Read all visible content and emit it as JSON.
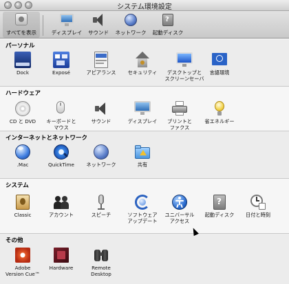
{
  "window": {
    "title": "システム環境設定"
  },
  "toolbar": {
    "items": [
      {
        "label": "すべてを表示",
        "icon": "apple-icon"
      },
      {
        "label": "ディスプレイ",
        "icon": "display-icon"
      },
      {
        "label": "サウンド",
        "icon": "speaker-icon"
      },
      {
        "label": "ネットワーク",
        "icon": "network-globe-icon"
      },
      {
        "label": "起動ディスク",
        "icon": "startup-disk-icon"
      }
    ]
  },
  "sections": [
    {
      "title": "パーソナル",
      "items": [
        {
          "label": "Dock",
          "icon": "dock-icon"
        },
        {
          "label": "Exposé",
          "icon": "expose-icon"
        },
        {
          "label": "アピアランス",
          "icon": "appearance-icon"
        },
        {
          "label": "セキュリティ",
          "icon": "security-house-icon"
        },
        {
          "label": "デスクトップと\nスクリーンセーバ",
          "icon": "desktop-screensaver-icon"
        },
        {
          "label": "言語環境",
          "icon": "international-flag-icon"
        }
      ]
    },
    {
      "title": "ハードウェア",
      "items": [
        {
          "label": "CD と DVD",
          "icon": "cd-dvd-icon"
        },
        {
          "label": "キーボードと\nマウス",
          "icon": "keyboard-mouse-icon"
        },
        {
          "label": "サウンド",
          "icon": "speaker-icon"
        },
        {
          "label": "ディスプレイ",
          "icon": "display-icon"
        },
        {
          "label": "プリントと\nファクス",
          "icon": "printer-icon"
        },
        {
          "label": "省エネルギー",
          "icon": "lightbulb-icon"
        }
      ]
    },
    {
      "title": "インターネットとネットワーク",
      "items": [
        {
          "label": ".Mac",
          "icon": "dotmac-icon"
        },
        {
          "label": "QuickTime",
          "icon": "quicktime-icon"
        },
        {
          "label": "ネットワーク",
          "icon": "network-globe-icon"
        },
        {
          "label": "共有",
          "icon": "sharing-folder-icon"
        }
      ]
    },
    {
      "title": "システム",
      "items": [
        {
          "label": "Classic",
          "icon": "classic-icon"
        },
        {
          "label": "アカウント",
          "icon": "accounts-icon"
        },
        {
          "label": "スピーチ",
          "icon": "microphone-icon"
        },
        {
          "label": "ソフトウェア\nアップデート",
          "icon": "software-update-icon"
        },
        {
          "label": "ユニバーサル\nアクセス",
          "icon": "universal-access-icon"
        },
        {
          "label": "起動ディスク",
          "icon": "startup-disk-icon"
        },
        {
          "label": "日付と時刻",
          "icon": "date-time-icon"
        }
      ]
    },
    {
      "title": "その他",
      "items": [
        {
          "label": "Adobe\nVersion Cue™",
          "icon": "adobe-version-cue-icon"
        },
        {
          "label": "Hardware",
          "icon": "hardware-chip-icon"
        },
        {
          "label": "Remote\nDesktop",
          "icon": "remote-desktop-binoculars-icon"
        }
      ]
    }
  ]
}
